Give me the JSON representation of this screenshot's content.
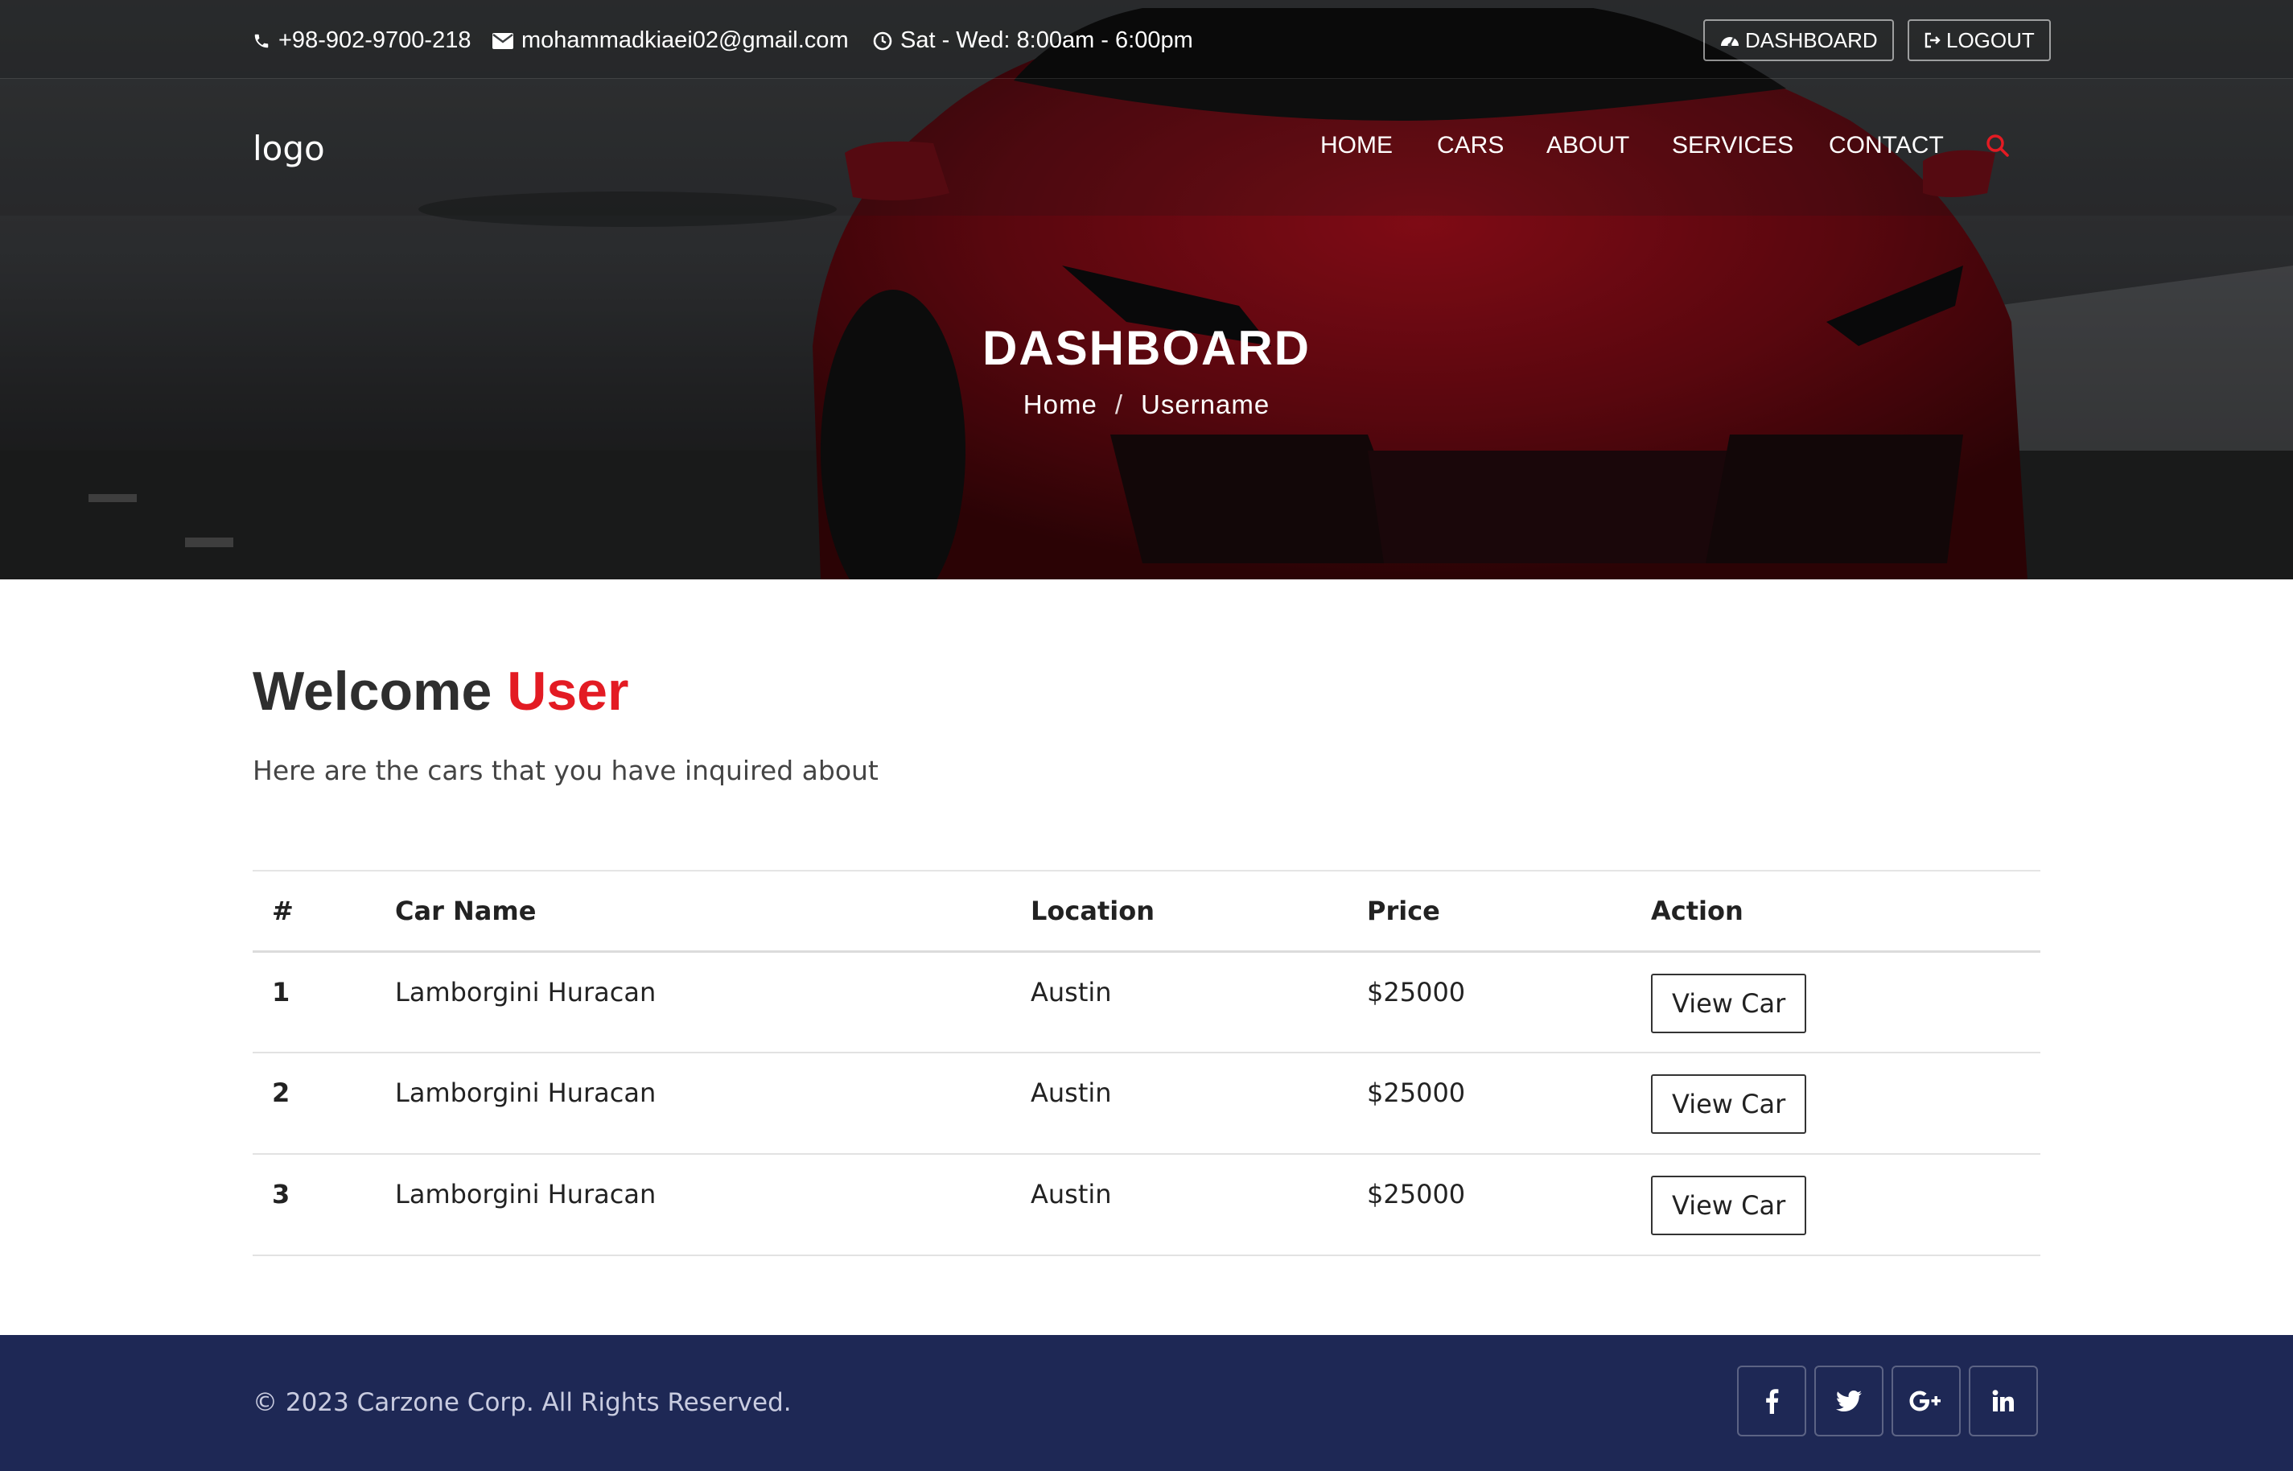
{
  "topbar": {
    "phone": "+98-902-9700-218",
    "email": "mohammadkiaei02@gmail.com",
    "hours": "Sat - Wed: 8:00am - 6:00pm",
    "dashboard_label": "DASHBOARD",
    "logout_label": "LOGOUT"
  },
  "navbar": {
    "logo": "logo",
    "links": [
      "HOME",
      "CARS",
      "ABOUT",
      "SERVICES",
      "CONTACT"
    ]
  },
  "hero": {
    "title": "DASHBOARD",
    "breadcrumb_home": "Home",
    "breadcrumb_sep": "/",
    "breadcrumb_current": "Username"
  },
  "main": {
    "welcome_prefix": "Welcome",
    "welcome_user": "User",
    "subtitle": "Here are the cars that you have inquired about"
  },
  "table": {
    "headers": [
      "#",
      "Car Name",
      "Location",
      "Price",
      "Action"
    ],
    "rows": [
      {
        "num": "1",
        "name": "Lamborgini Huracan",
        "location": "Austin",
        "price": "$25000",
        "action": "View Car"
      },
      {
        "num": "2",
        "name": "Lamborgini Huracan",
        "location": "Austin",
        "price": "$25000",
        "action": "View Car"
      },
      {
        "num": "3",
        "name": "Lamborgini Huracan",
        "location": "Austin",
        "price": "$25000",
        "action": "View Car"
      }
    ]
  },
  "footer": {
    "copyright": "© 2023 Carzone Corp. All Rights Reserved.",
    "social": [
      "facebook-icon",
      "twitter-icon",
      "google-plus-icon",
      "linkedin-icon"
    ]
  },
  "colors": {
    "accent": "#e31b23",
    "footer_bg": "#1e2855"
  }
}
